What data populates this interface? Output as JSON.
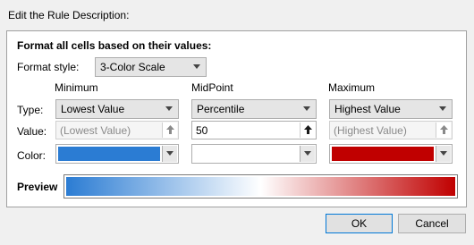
{
  "dialog": {
    "section_label": "Edit the Rule Description:",
    "heading": "Format all cells based on their values:",
    "format_style_label": "Format style:",
    "format_style_value": "3-Color Scale",
    "row_labels": {
      "type": "Type:",
      "value": "Value:",
      "color": "Color:"
    },
    "columns": [
      {
        "header": "Minimum",
        "type": "Lowest Value",
        "value": "(Lowest Value)",
        "value_disabled": true,
        "color": "#2b7cd3"
      },
      {
        "header": "MidPoint",
        "type": "Percentile",
        "value": "50",
        "value_disabled": false,
        "color": "#ffffff"
      },
      {
        "header": "Maximum",
        "type": "Highest Value",
        "value": "(Highest Value)",
        "value_disabled": true,
        "color": "#c00000"
      }
    ],
    "preview_label": "Preview",
    "ok_label": "OK",
    "cancel_label": "Cancel"
  }
}
